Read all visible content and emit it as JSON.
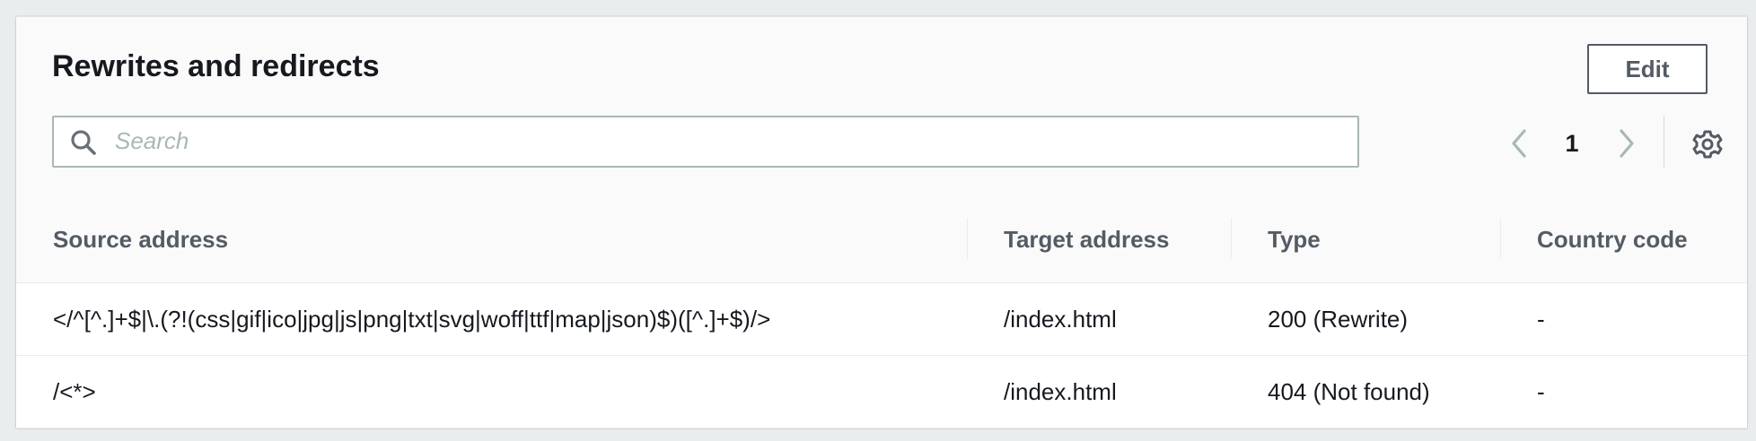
{
  "section": {
    "title": "Rewrites and redirects",
    "edit_label": "Edit"
  },
  "search": {
    "placeholder": "Search",
    "value": ""
  },
  "pagination": {
    "current_page": "1"
  },
  "table": {
    "columns": [
      "Source address",
      "Target address",
      "Type",
      "Country code"
    ],
    "rows": [
      {
        "source": "</^[^.]+$|\\.(?!(css|gif|ico|jpg|js|png|txt|svg|woff|ttf|map|json)$)([^.]+$)/>",
        "target": "/index.html",
        "type": "200 (Rewrite)",
        "country": "-"
      },
      {
        "source": "/<*>",
        "target": "/index.html",
        "type": "404 (Not found)",
        "country": "-"
      }
    ]
  },
  "icons": {
    "search": "search-icon",
    "prev": "chevron-left-icon",
    "next": "chevron-right-icon",
    "settings": "gear-icon"
  },
  "colors": {
    "background": "#eaeded",
    "text": "#16191f",
    "muted": "#545b64",
    "border": "#aab7b8"
  }
}
